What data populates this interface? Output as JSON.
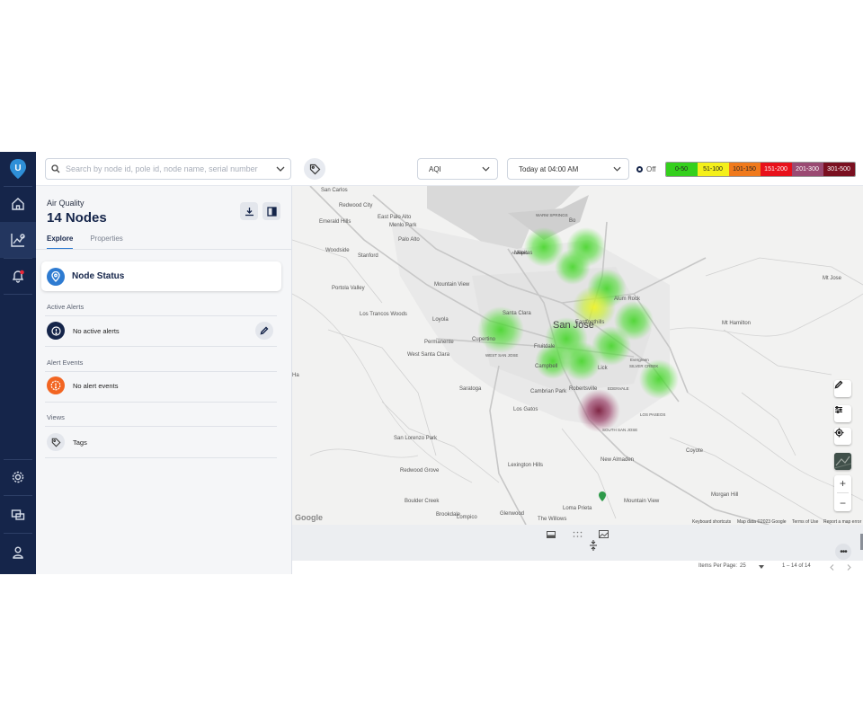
{
  "nav": {
    "logo": "U"
  },
  "search": {
    "placeholder": "Search by node id, pole id, node name, serial number"
  },
  "filters": {
    "metric": "AQI",
    "time": "Today at 04:00 AM"
  },
  "legend": {
    "off_label": "Off",
    "bands": [
      {
        "label": "0-50",
        "color": "#34d01c"
      },
      {
        "label": "51-100",
        "color": "#f4f01a"
      },
      {
        "label": "101-150",
        "color": "#f07a1c"
      },
      {
        "label": "151-200",
        "color": "#e8111b"
      },
      {
        "label": "201-300",
        "color": "#9a4a72"
      },
      {
        "label": "301-500",
        "color": "#7a1020"
      }
    ]
  },
  "panel": {
    "subtitle": "Air Quality",
    "title": "14 Nodes",
    "tabs": [
      "Explore",
      "Properties"
    ],
    "node_status": "Node Status",
    "active_alerts": {
      "heading": "Active Alerts",
      "text": "No active alerts"
    },
    "alert_events": {
      "heading": "Alert Events",
      "text": "No alert events"
    },
    "views": {
      "heading": "Views",
      "text": "Tags"
    }
  },
  "map": {
    "labels": [
      {
        "t": "San Carlos",
        "s": "sm"
      },
      {
        "t": "Redwood City",
        "s": "sm"
      },
      {
        "t": "Emerald Hills",
        "s": "sm"
      },
      {
        "t": "East Palo Alto",
        "s": "sm"
      },
      {
        "t": "Menlo Park",
        "s": "sm"
      },
      {
        "t": "Palo Alto",
        "s": "sm"
      },
      {
        "t": "Woodside",
        "s": "sm"
      },
      {
        "t": "Stanford",
        "s": "sm"
      },
      {
        "t": "Portola Valley",
        "s": "sm"
      },
      {
        "t": "Mountain View",
        "s": "sm"
      },
      {
        "t": "Los Trancos Woods",
        "s": "sm"
      },
      {
        "t": "Loyola",
        "s": "sm"
      },
      {
        "t": "Santa Clara",
        "s": "sm"
      },
      {
        "t": "San Jose",
        "s": "lg"
      },
      {
        "t": "Cupertino",
        "s": "sm"
      },
      {
        "t": "Permanente",
        "s": "sm"
      },
      {
        "t": "West Santa Clara",
        "s": "sm"
      },
      {
        "t": "WEST SAN JOSE",
        "s": "xs"
      },
      {
        "t": "Campbell",
        "s": "sm"
      },
      {
        "t": "Saratoga",
        "s": "sm"
      },
      {
        "t": "Cambrian Park",
        "s": "sm"
      },
      {
        "t": "Los Gatos",
        "s": "sm"
      },
      {
        "t": "Robertsville",
        "s": "sm"
      },
      {
        "t": "EDENVALE",
        "s": "xs"
      },
      {
        "t": "SOUTH SAN JOSE",
        "s": "xs"
      },
      {
        "t": "LOS PASEOS",
        "s": "xs"
      },
      {
        "t": "New Almaden",
        "s": "sm"
      },
      {
        "t": "San Lorenzo Park",
        "s": "sm"
      },
      {
        "t": "Redwood Grove",
        "s": "sm"
      },
      {
        "t": "Lexington Hills",
        "s": "sm"
      },
      {
        "t": "Boulder Creek",
        "s": "sm"
      },
      {
        "t": "Brookdale",
        "s": "sm"
      },
      {
        "t": "Lompico",
        "s": "sm"
      },
      {
        "t": "Glenwood",
        "s": "sm"
      },
      {
        "t": "Loma Prieta",
        "s": "sm"
      },
      {
        "t": "The Willows",
        "s": "sm"
      },
      {
        "t": "Mountain View",
        "s": "sm"
      },
      {
        "t": "Coyote",
        "s": "sm"
      },
      {
        "t": "Morgan Hill",
        "s": "sm"
      },
      {
        "t": "Mt Hamilton",
        "s": "sm"
      },
      {
        "t": "Mt Jose",
        "s": "sm"
      },
      {
        "t": "Alviso",
        "s": "xs"
      },
      {
        "t": "Milpitas",
        "s": "sm"
      },
      {
        "t": "WARM SPRINGS",
        "s": "xs"
      },
      {
        "t": "ALVISO",
        "s": "xs"
      },
      {
        "t": "Fruitdale",
        "s": "sm"
      },
      {
        "t": "Eastfoothills",
        "s": "sm"
      },
      {
        "t": "Evergreen",
        "s": "xs"
      },
      {
        "t": "SILVER CREEK",
        "s": "xs"
      },
      {
        "t": "Lick",
        "s": "sm"
      },
      {
        "t": "Alum Rock",
        "s": "sm"
      },
      {
        "t": "Ha",
        "s": "sm"
      },
      {
        "t": "Bo",
        "s": "sm"
      }
    ],
    "google": "Google",
    "attribution": [
      "Keyboard shortcuts",
      "Map data ©2023 Google",
      "Terms of Use",
      "Report a map error"
    ]
  },
  "pager": {
    "items_label": "Items Per Page:",
    "items_value": "25",
    "range": "1 – 14 of 14"
  }
}
